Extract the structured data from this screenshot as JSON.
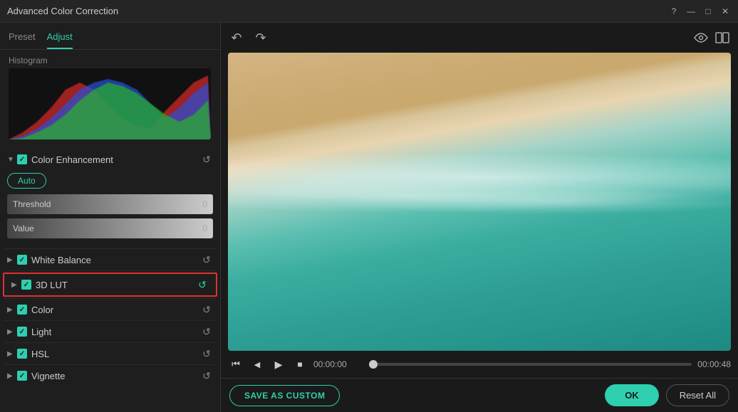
{
  "window": {
    "title": "Advanced Color Correction"
  },
  "titlebar_controls": {
    "help": "?",
    "minimize": "—",
    "maximize": "□",
    "close": "✕"
  },
  "tabs": [
    {
      "id": "preset",
      "label": "Preset",
      "active": false
    },
    {
      "id": "adjust",
      "label": "Adjust",
      "active": true
    }
  ],
  "histogram": {
    "label": "Histogram"
  },
  "toolbar": {
    "undo": "↩",
    "redo": "↪",
    "eye": "👁",
    "compare": "⧉"
  },
  "sections": [
    {
      "id": "color-enhancement",
      "label": "Color Enhancement",
      "checked": true,
      "expanded": true,
      "highlighted": false,
      "sliders": [
        {
          "label": "Threshold",
          "value": "0"
        },
        {
          "label": "Value",
          "value": "0"
        }
      ]
    },
    {
      "id": "white-balance",
      "label": "White Balance",
      "checked": true,
      "expanded": false,
      "highlighted": false
    },
    {
      "id": "3d-lut",
      "label": "3D LUT",
      "checked": true,
      "expanded": false,
      "highlighted": true
    },
    {
      "id": "color",
      "label": "Color",
      "checked": true,
      "expanded": false,
      "highlighted": false
    },
    {
      "id": "light",
      "label": "Light",
      "checked": true,
      "expanded": false,
      "highlighted": false
    },
    {
      "id": "hsl",
      "label": "HSL",
      "checked": true,
      "expanded": false,
      "highlighted": false
    },
    {
      "id": "vignette",
      "label": "Vignette",
      "checked": true,
      "expanded": false,
      "highlighted": false
    }
  ],
  "auto_btn": "Auto",
  "playback": {
    "time_current": "00:00:00",
    "time_end": "00:00:48"
  },
  "buttons": {
    "save_as_custom": "SAVE AS CUSTOM",
    "ok": "OK",
    "reset_all": "Reset All"
  }
}
